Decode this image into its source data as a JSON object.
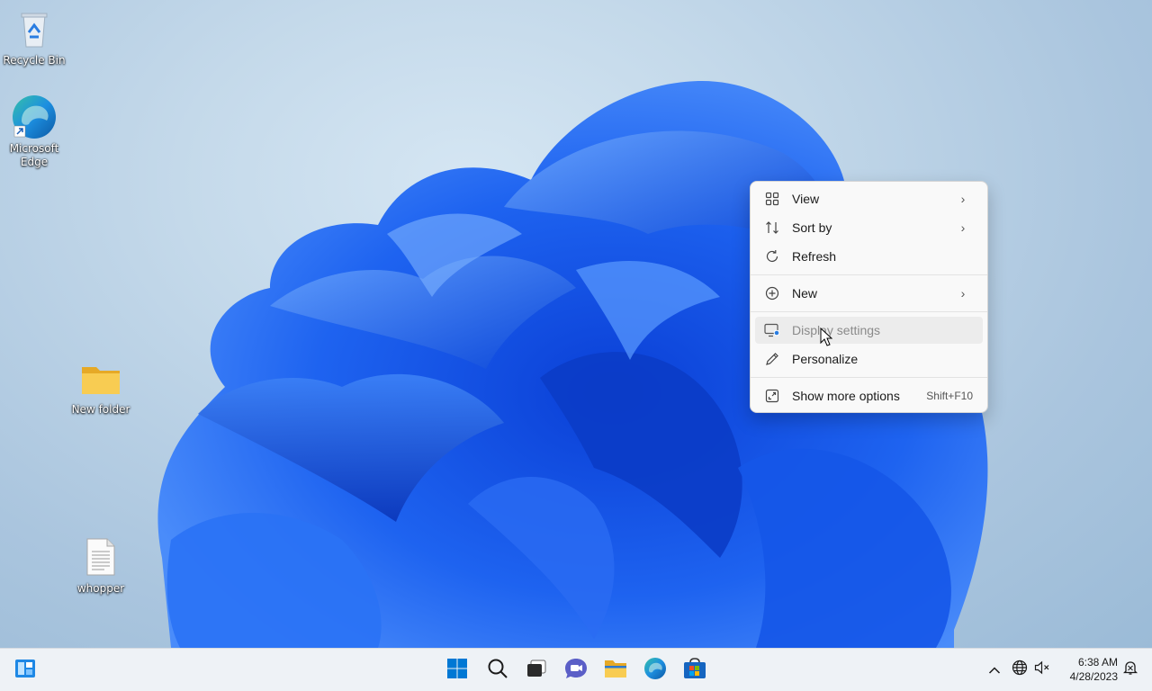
{
  "desktop": {
    "icons": [
      {
        "label": "Recycle Bin",
        "icon": "recycle-bin-icon"
      },
      {
        "label": "Microsoft Edge",
        "icon": "edge-icon"
      },
      {
        "label": "New folder",
        "icon": "folder-icon"
      },
      {
        "label": "whopper",
        "icon": "text-file-icon"
      }
    ]
  },
  "context_menu": {
    "items": [
      {
        "label": "View",
        "icon": "grid-icon",
        "submenu": true
      },
      {
        "label": "Sort by",
        "icon": "sort-icon",
        "submenu": true
      },
      {
        "label": "Refresh",
        "icon": "refresh-icon"
      },
      {
        "label": "New",
        "icon": "plus-circle-icon",
        "submenu": true
      },
      {
        "label": "Display settings",
        "icon": "display-icon",
        "state": "hover"
      },
      {
        "label": "Personalize",
        "icon": "pen-icon"
      },
      {
        "label": "Show more options",
        "icon": "expand-icon",
        "shortcut": "Shift+F10"
      }
    ],
    "submenu_glyph": "›"
  },
  "taskbar": {
    "items": [
      {
        "name": "widgets",
        "icon": "widgets-icon"
      },
      {
        "name": "start",
        "icon": "windows-logo-icon"
      },
      {
        "name": "search",
        "icon": "search-icon"
      },
      {
        "name": "task-view",
        "icon": "task-view-icon"
      },
      {
        "name": "chat",
        "icon": "chat-icon"
      },
      {
        "name": "file-explorer",
        "icon": "folder-icon"
      },
      {
        "name": "edge",
        "icon": "edge-icon"
      },
      {
        "name": "store",
        "icon": "store-icon"
      }
    ],
    "tray": {
      "items": [
        {
          "name": "show-hidden",
          "icon": "chevron-up-icon"
        },
        {
          "name": "language",
          "icon": "globe-icon"
        },
        {
          "name": "volume",
          "icon": "speaker-muted-icon"
        }
      ],
      "time": "6:38 AM",
      "date": "4/28/2023",
      "notification_icon": "notification-icon"
    },
    "accent_colors": {
      "windows_blue": "#0078d4",
      "chat_purple": "#5b5fc7",
      "folder_yellow": "#f8c84a"
    }
  }
}
